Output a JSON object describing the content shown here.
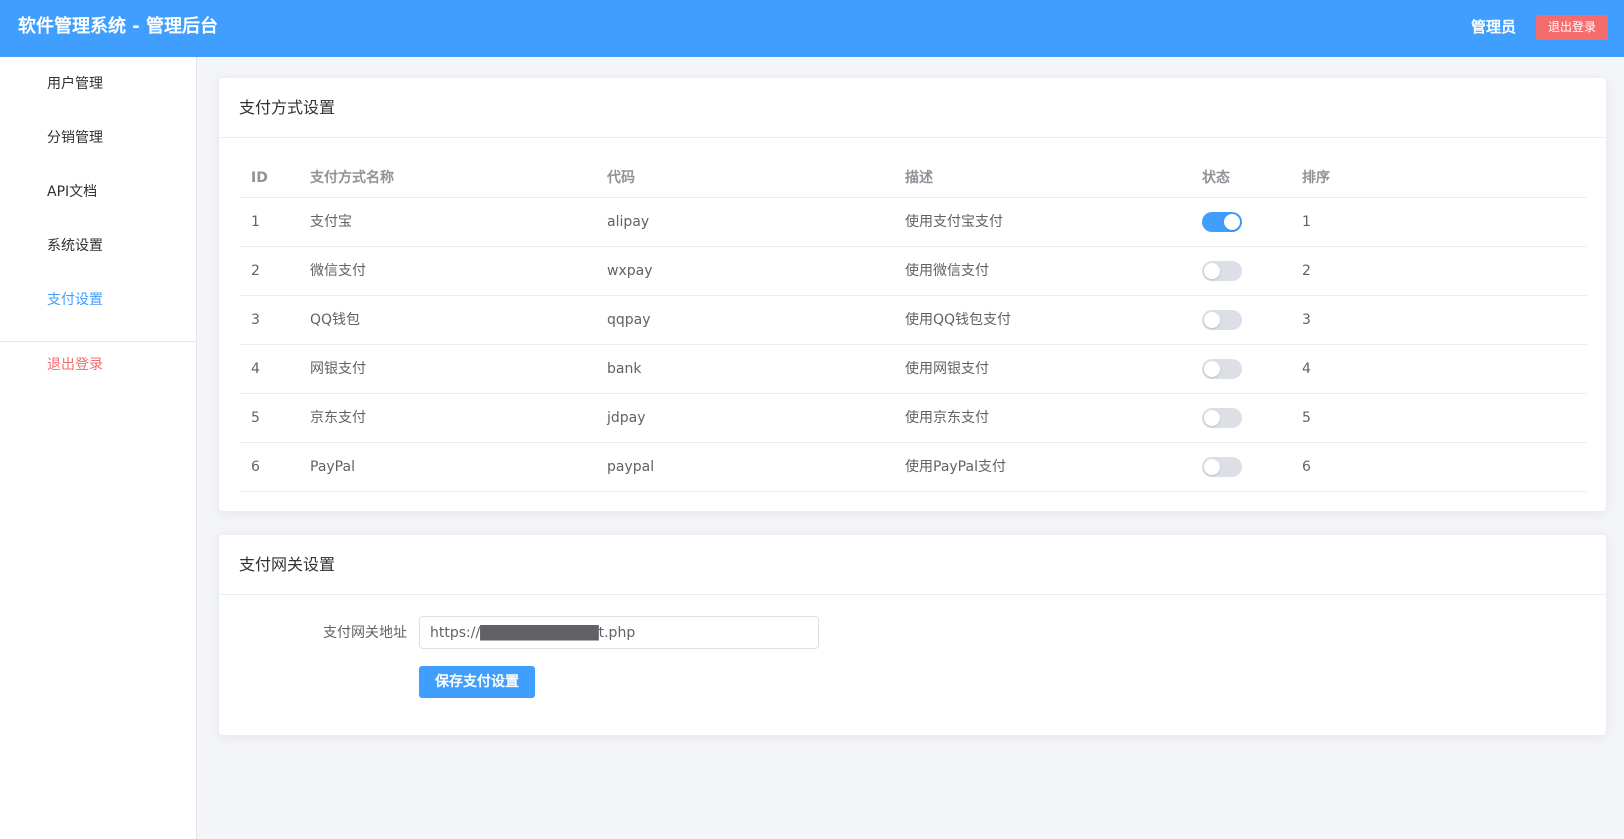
{
  "header": {
    "title": "软件管理系统 - 管理后台",
    "user": "管理员",
    "logout_label": "退出登录"
  },
  "sidebar": {
    "items": [
      {
        "label": "用户管理"
      },
      {
        "label": "分销管理"
      },
      {
        "label": "API文档"
      },
      {
        "label": "系统设置"
      },
      {
        "label": "支付设置"
      }
    ],
    "logout_label": "退出登录"
  },
  "payment_methods": {
    "title": "支付方式设置",
    "columns": [
      "ID",
      "支付方式名称",
      "代码",
      "描述",
      "状态",
      "排序"
    ],
    "rows": [
      {
        "id": "1",
        "name": "支付宝",
        "code": "alipay",
        "desc": "使用支付宝支付",
        "enabled": true,
        "sort": "1"
      },
      {
        "id": "2",
        "name": "微信支付",
        "code": "wxpay",
        "desc": "使用微信支付",
        "enabled": false,
        "sort": "2"
      },
      {
        "id": "3",
        "name": "QQ钱包",
        "code": "qqpay",
        "desc": "使用QQ钱包支付",
        "enabled": false,
        "sort": "3"
      },
      {
        "id": "4",
        "name": "网银支付",
        "code": "bank",
        "desc": "使用网银支付",
        "enabled": false,
        "sort": "4"
      },
      {
        "id": "5",
        "name": "京东支付",
        "code": "jdpay",
        "desc": "使用京东支付",
        "enabled": false,
        "sort": "5"
      },
      {
        "id": "6",
        "name": "PayPal",
        "code": "paypal",
        "desc": "使用PayPal支付",
        "enabled": false,
        "sort": "6"
      }
    ]
  },
  "gateway": {
    "title": "支付网关设置",
    "label": "支付网关地址",
    "value": "https://███████████t.php",
    "save_label": "保存支付设置"
  }
}
